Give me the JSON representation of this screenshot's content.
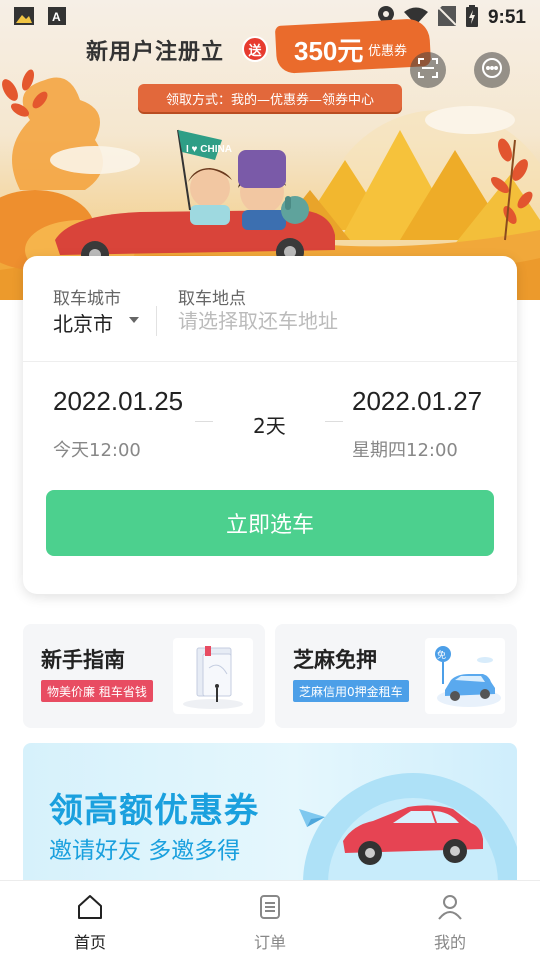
{
  "status_bar": {
    "time": "9:51",
    "left_icons": [
      "photo-icon",
      "text-a-icon"
    ],
    "right_icons": [
      "location-icon",
      "wifi-icon",
      "no-sim-icon",
      "battery-charging-icon"
    ]
  },
  "banner": {
    "headline": "新用户注册立",
    "send_badge": "送",
    "amount": "350元",
    "amount_unit": "优惠券",
    "claim_method": "领取方式：我的—优惠券—领券中心",
    "flag_text": "I ♥ CHINA",
    "scan_icon": "scan-icon",
    "message_icon": "message-icon"
  },
  "search_card": {
    "city_label": "取车城市",
    "city_value": "北京市",
    "location_label": "取车地点",
    "location_placeholder": "请选择取还车地址",
    "pickup_date": "2022.01.25",
    "pickup_sub": "今天12:00",
    "duration": "2天",
    "return_date": "2022.01.27",
    "return_sub": "星期四12:00",
    "cta_label": "立即选车",
    "cta_color": "#4cd08e"
  },
  "features": [
    {
      "title": "新手指南",
      "tag": "物美价廉 租车省钱",
      "tag_color": "#e84c62"
    },
    {
      "title": "芝麻免押",
      "tag": "芝麻信用0押金租车",
      "tag_color": "#4c9fe8",
      "badge": "免"
    }
  ],
  "invite_banner": {
    "title": "领高额优惠券",
    "subtitle": "邀请好友 多邀多得"
  },
  "bottom_nav": [
    {
      "label": "首页",
      "icon": "home-icon",
      "active": true
    },
    {
      "label": "订单",
      "icon": "order-icon",
      "active": false
    },
    {
      "label": "我的",
      "icon": "profile-icon",
      "active": false
    }
  ]
}
